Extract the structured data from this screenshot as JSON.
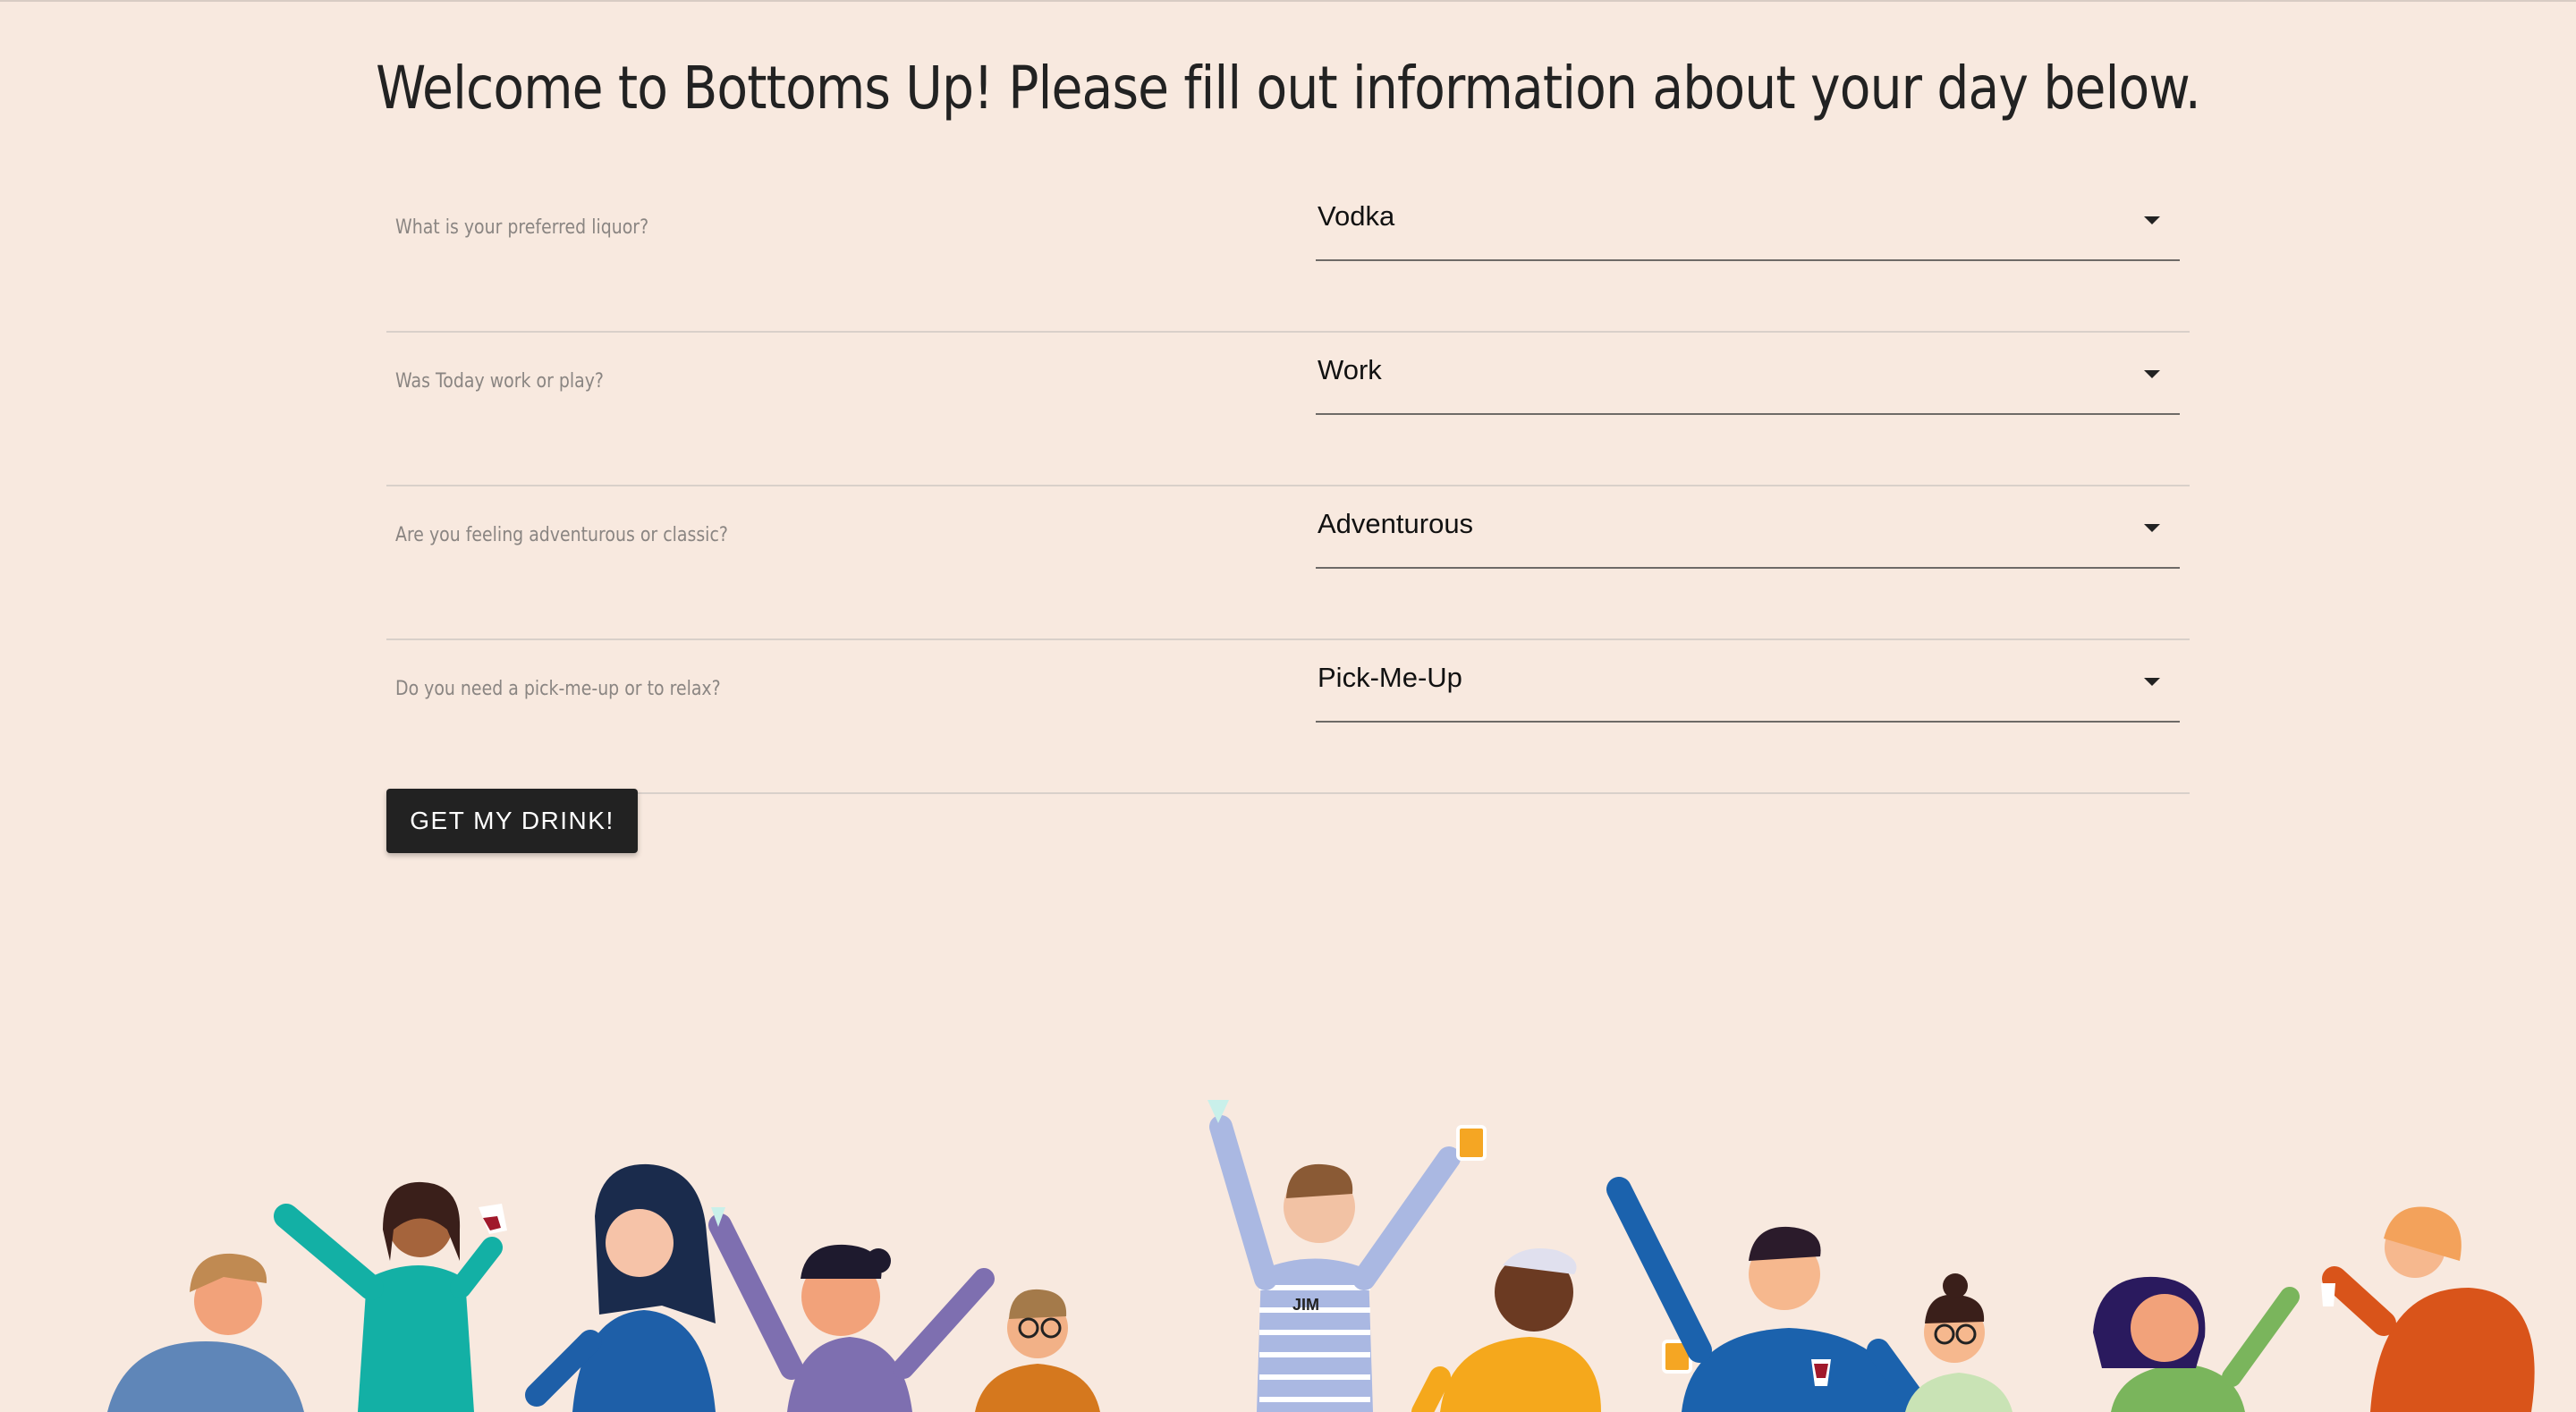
{
  "page": {
    "title": "Welcome to Bottoms Up! Please fill out information about your day below."
  },
  "form": {
    "questions": [
      {
        "label": "What is your preferred liquor?",
        "selected": "Vodka"
      },
      {
        "label": "Was Today work or play?",
        "selected": "Work"
      },
      {
        "label": "Are you feeling adventurous or classic?",
        "selected": "Adventurous"
      },
      {
        "label": "Do you need a pick-me-up or to relax?",
        "selected": "Pick-Me-Up"
      }
    ],
    "submit_label": "GET MY DRINK!"
  },
  "illustration": {
    "shirt_text": "JIM"
  }
}
